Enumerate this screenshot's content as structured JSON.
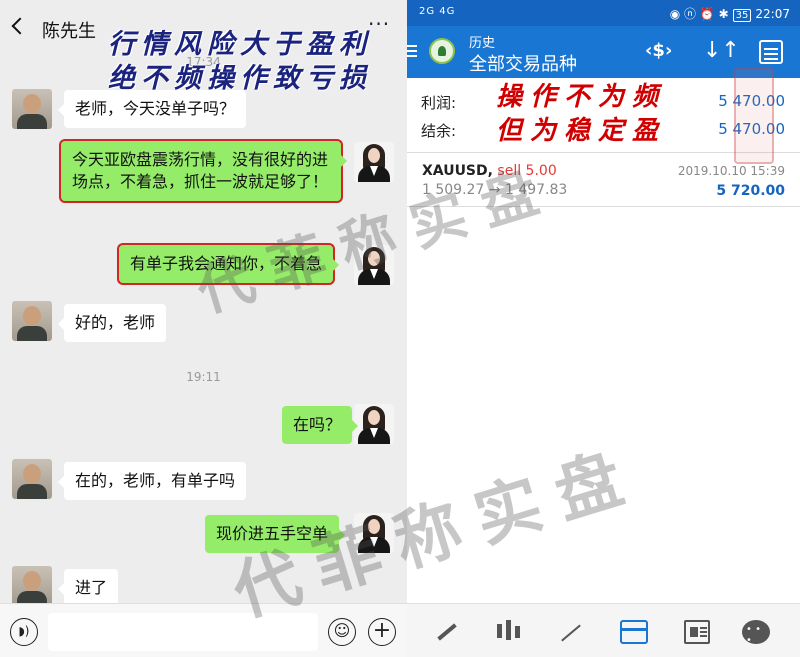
{
  "chat": {
    "title": "陈先生",
    "more_glyph": "···",
    "time_1": "17:34",
    "time_2": "19:11",
    "messages": [
      {
        "side": "in",
        "text": "老师，今天没单子吗？"
      },
      {
        "side": "out",
        "text": "今天亚欧盘震荡行情，没有很好的进场点，不着急，抓住一波就足够了！",
        "highlighted": true
      },
      {
        "side": "out",
        "text": "有单子我会通知你，不着急",
        "highlighted": true
      },
      {
        "side": "in",
        "text": "好的，老师"
      },
      {
        "side": "out",
        "text": "在吗？"
      },
      {
        "side": "in",
        "text": "在的，老师，有单子吗"
      },
      {
        "side": "out",
        "text": "现价进五手空单"
      },
      {
        "side": "in",
        "text": "进了"
      }
    ],
    "input": {
      "voice_icon": "voice-icon",
      "emoji_icon": "emoji-icon",
      "plus_icon": "plus-icon"
    }
  },
  "app": {
    "status_left": "2G 4G",
    "status_battery": "35",
    "status_time": "22:07",
    "title": "历史",
    "subtitle": "全部交易品种",
    "summary": [
      {
        "label": "利润:",
        "value": "5 470.00"
      },
      {
        "label": "结余:",
        "value": "5 470.00"
      }
    ],
    "trade": {
      "symbol": "XAUUSD,",
      "side": " sell 5.00",
      "date": "2019.10.10 15:39",
      "prices": "1 509.27 → 1 497.83",
      "profit": "5 720.00"
    },
    "nav_icons": [
      "quotes-icon",
      "chart-icon",
      "trade-icon",
      "history-icon",
      "news-icon",
      "chat-icon"
    ]
  },
  "overlays": {
    "left_line_1": "行情风险大于盈利",
    "left_line_2": "绝不频操作致亏损",
    "right_line_1": "操作不为频",
    "right_line_2": "但为稳定盈",
    "watermark_1": "代菲称实盘",
    "watermark_2": "代菲称实盘"
  },
  "colors": {
    "accent": "#1976d2",
    "chat_out": "#95ec69",
    "highlight": "#d22525",
    "loss": "#e53935"
  }
}
